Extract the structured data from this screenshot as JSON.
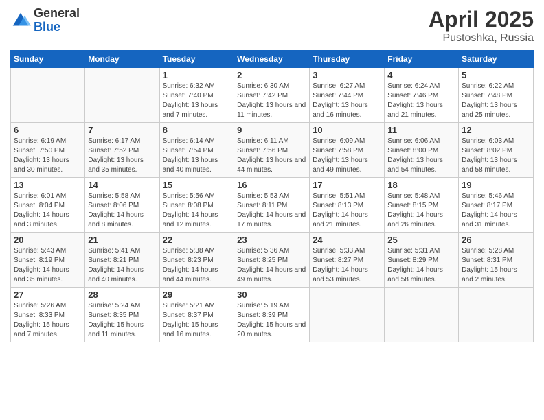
{
  "logo": {
    "general": "General",
    "blue": "Blue"
  },
  "title": {
    "month": "April 2025",
    "location": "Pustoshka, Russia"
  },
  "weekdays": [
    "Sunday",
    "Monday",
    "Tuesday",
    "Wednesday",
    "Thursday",
    "Friday",
    "Saturday"
  ],
  "weeks": [
    [
      {
        "day": "",
        "info": ""
      },
      {
        "day": "",
        "info": ""
      },
      {
        "day": "1",
        "info": "Sunrise: 6:32 AM\nSunset: 7:40 PM\nDaylight: 13 hours and 7 minutes."
      },
      {
        "day": "2",
        "info": "Sunrise: 6:30 AM\nSunset: 7:42 PM\nDaylight: 13 hours and 11 minutes."
      },
      {
        "day": "3",
        "info": "Sunrise: 6:27 AM\nSunset: 7:44 PM\nDaylight: 13 hours and 16 minutes."
      },
      {
        "day": "4",
        "info": "Sunrise: 6:24 AM\nSunset: 7:46 PM\nDaylight: 13 hours and 21 minutes."
      },
      {
        "day": "5",
        "info": "Sunrise: 6:22 AM\nSunset: 7:48 PM\nDaylight: 13 hours and 25 minutes."
      }
    ],
    [
      {
        "day": "6",
        "info": "Sunrise: 6:19 AM\nSunset: 7:50 PM\nDaylight: 13 hours and 30 minutes."
      },
      {
        "day": "7",
        "info": "Sunrise: 6:17 AM\nSunset: 7:52 PM\nDaylight: 13 hours and 35 minutes."
      },
      {
        "day": "8",
        "info": "Sunrise: 6:14 AM\nSunset: 7:54 PM\nDaylight: 13 hours and 40 minutes."
      },
      {
        "day": "9",
        "info": "Sunrise: 6:11 AM\nSunset: 7:56 PM\nDaylight: 13 hours and 44 minutes."
      },
      {
        "day": "10",
        "info": "Sunrise: 6:09 AM\nSunset: 7:58 PM\nDaylight: 13 hours and 49 minutes."
      },
      {
        "day": "11",
        "info": "Sunrise: 6:06 AM\nSunset: 8:00 PM\nDaylight: 13 hours and 54 minutes."
      },
      {
        "day": "12",
        "info": "Sunrise: 6:03 AM\nSunset: 8:02 PM\nDaylight: 13 hours and 58 minutes."
      }
    ],
    [
      {
        "day": "13",
        "info": "Sunrise: 6:01 AM\nSunset: 8:04 PM\nDaylight: 14 hours and 3 minutes."
      },
      {
        "day": "14",
        "info": "Sunrise: 5:58 AM\nSunset: 8:06 PM\nDaylight: 14 hours and 8 minutes."
      },
      {
        "day": "15",
        "info": "Sunrise: 5:56 AM\nSunset: 8:08 PM\nDaylight: 14 hours and 12 minutes."
      },
      {
        "day": "16",
        "info": "Sunrise: 5:53 AM\nSunset: 8:11 PM\nDaylight: 14 hours and 17 minutes."
      },
      {
        "day": "17",
        "info": "Sunrise: 5:51 AM\nSunset: 8:13 PM\nDaylight: 14 hours and 21 minutes."
      },
      {
        "day": "18",
        "info": "Sunrise: 5:48 AM\nSunset: 8:15 PM\nDaylight: 14 hours and 26 minutes."
      },
      {
        "day": "19",
        "info": "Sunrise: 5:46 AM\nSunset: 8:17 PM\nDaylight: 14 hours and 31 minutes."
      }
    ],
    [
      {
        "day": "20",
        "info": "Sunrise: 5:43 AM\nSunset: 8:19 PM\nDaylight: 14 hours and 35 minutes."
      },
      {
        "day": "21",
        "info": "Sunrise: 5:41 AM\nSunset: 8:21 PM\nDaylight: 14 hours and 40 minutes."
      },
      {
        "day": "22",
        "info": "Sunrise: 5:38 AM\nSunset: 8:23 PM\nDaylight: 14 hours and 44 minutes."
      },
      {
        "day": "23",
        "info": "Sunrise: 5:36 AM\nSunset: 8:25 PM\nDaylight: 14 hours and 49 minutes."
      },
      {
        "day": "24",
        "info": "Sunrise: 5:33 AM\nSunset: 8:27 PM\nDaylight: 14 hours and 53 minutes."
      },
      {
        "day": "25",
        "info": "Sunrise: 5:31 AM\nSunset: 8:29 PM\nDaylight: 14 hours and 58 minutes."
      },
      {
        "day": "26",
        "info": "Sunrise: 5:28 AM\nSunset: 8:31 PM\nDaylight: 15 hours and 2 minutes."
      }
    ],
    [
      {
        "day": "27",
        "info": "Sunrise: 5:26 AM\nSunset: 8:33 PM\nDaylight: 15 hours and 7 minutes."
      },
      {
        "day": "28",
        "info": "Sunrise: 5:24 AM\nSunset: 8:35 PM\nDaylight: 15 hours and 11 minutes."
      },
      {
        "day": "29",
        "info": "Sunrise: 5:21 AM\nSunset: 8:37 PM\nDaylight: 15 hours and 16 minutes."
      },
      {
        "day": "30",
        "info": "Sunrise: 5:19 AM\nSunset: 8:39 PM\nDaylight: 15 hours and 20 minutes."
      },
      {
        "day": "",
        "info": ""
      },
      {
        "day": "",
        "info": ""
      },
      {
        "day": "",
        "info": ""
      }
    ]
  ]
}
